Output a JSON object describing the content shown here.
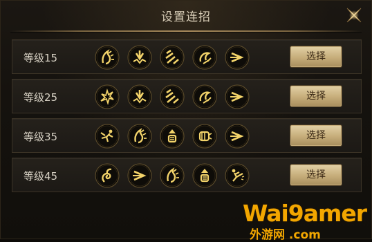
{
  "dialog": {
    "title": "设置连招"
  },
  "combos": [
    {
      "level_label": "等级15",
      "select_label": "选择",
      "skills": [
        "flame-spiral-icon",
        "burst-down-icon",
        "triple-slash-icon",
        "swirl-strike-icon",
        "dash-arrow-icon"
      ]
    },
    {
      "level_label": "等级25",
      "select_label": "选择",
      "skills": [
        "crack-burst-icon",
        "burst-down-icon",
        "triple-slash-icon",
        "swirl-strike-icon",
        "dash-arrow-icon"
      ]
    },
    {
      "level_label": "等级35",
      "select_label": "选择",
      "skills": [
        "lunge-figure-icon",
        "flame-spiral-icon",
        "rising-fist-icon",
        "punch-fist-icon",
        "dash-arrow-icon"
      ]
    },
    {
      "level_label": "等级45",
      "select_label": "选择",
      "skills": [
        "coil-spiral-icon",
        "dash-arrow-icon",
        "flame-spiral-icon",
        "rising-fist-icon",
        "kick-figure-icon"
      ]
    }
  ],
  "watermark": {
    "main": "Wai9amer",
    "sub": "外游网 .com"
  },
  "colors": {
    "accent_gold": "#f2d36a",
    "button_gold": "#d2bb8a",
    "watermark_orange": "#f2a600"
  }
}
